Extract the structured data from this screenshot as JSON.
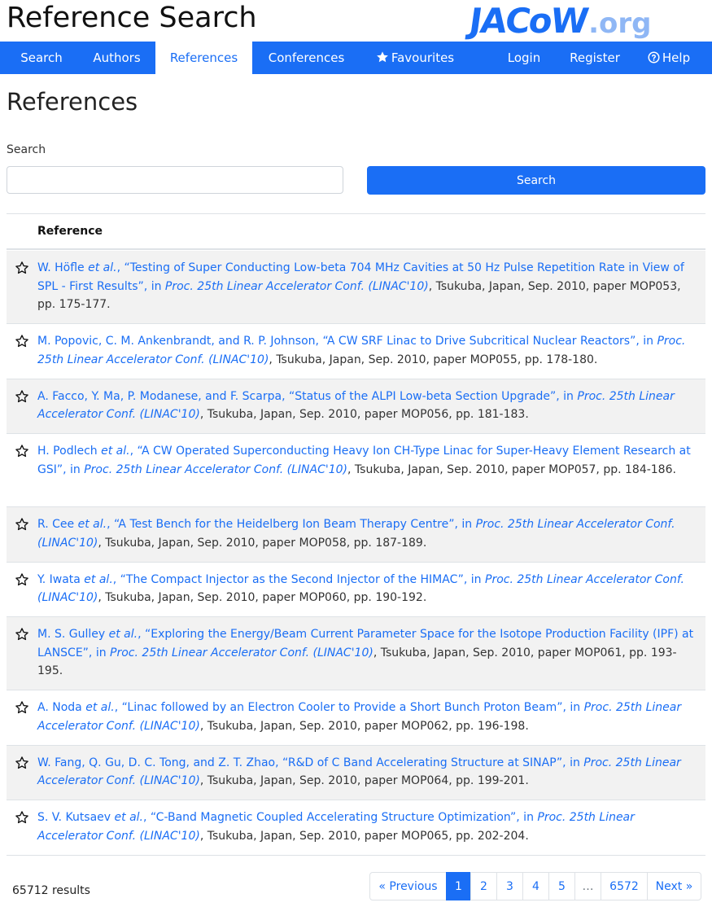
{
  "header": {
    "title": "Reference Search",
    "logo_main": "JACoW",
    "logo_ext": ".org"
  },
  "nav": {
    "search": "Search",
    "authors": "Authors",
    "references": "References",
    "conferences": "Conferences",
    "favourites": "Favourites",
    "login": "Login",
    "register": "Register",
    "help": "Help"
  },
  "page": {
    "heading": "References",
    "search_label": "Search",
    "search_value": "",
    "search_button": "Search",
    "column_header": "Reference"
  },
  "references": [
    {
      "authors": "W. Höfle",
      "etal": "et al.",
      "title": ", “Testing of Super Conducting Low-beta 704 MHz Cavities at 50 Hz Pulse Repetition Rate in View of SPL - First Results”, in ",
      "conf": "Proc. 25th Linear Accelerator Conf. (LINAC'10)",
      "details": ", Tsukuba, Japan, Sep. 2010, paper MOP053, pp. 175-177."
    },
    {
      "authors": "M. Popovic, C. M. Ankenbrandt, and R. P. Johnson",
      "etal": "",
      "title": ", “A CW SRF Linac to Drive Subcritical Nuclear Reactors”, in ",
      "conf": "Proc. 25th Linear Accelerator Conf. (LINAC'10)",
      "details": ", Tsukuba, Japan, Sep. 2010, paper MOP055, pp. 178-180."
    },
    {
      "authors": "A. Facco, Y. Ma, P. Modanese, and F. Scarpa",
      "etal": "",
      "title": ", “Status of the ALPI Low-beta Section Upgrade”, in ",
      "conf": "Proc. 25th Linear Accelerator Conf. (LINAC'10)",
      "details": ", Tsukuba, Japan, Sep. 2010, paper MOP056, pp. 181-183."
    },
    {
      "authors": "H. Podlech",
      "etal": "et al.",
      "title": ", “A CW Operated Superconducting Heavy Ion CH-Type Linac for Super-Heavy Element Research at GSI”, in ",
      "conf": "Proc. 25th Linear Accelerator Conf. (LINAC'10)",
      "details": ", Tsukuba, Japan, Sep. 2010, paper MOP057, pp. 184-186."
    },
    {
      "authors": "R. Cee",
      "etal": "et al.",
      "title": ", “A Test Bench for the Heidelberg Ion Beam Therapy Centre”, in ",
      "conf": "Proc. 25th Linear Accelerator Conf. (LINAC'10)",
      "details": ", Tsukuba, Japan, Sep. 2010, paper MOP058, pp. 187-189."
    },
    {
      "authors": "Y. Iwata",
      "etal": "et al.",
      "title": ", “The Compact Injector as the Second Injector of the HIMAC”, in ",
      "conf": "Proc. 25th Linear Accelerator Conf. (LINAC'10)",
      "details": ", Tsukuba, Japan, Sep. 2010, paper MOP060, pp. 190-192."
    },
    {
      "authors": "M. S. Gulley",
      "etal": "et al.",
      "title": ", “Exploring the Energy/Beam Current Parameter Space for the Isotope Production Facility (IPF) at LANSCE”, in ",
      "conf": "Proc. 25th Linear Accelerator Conf. (LINAC'10)",
      "details": ", Tsukuba, Japan, Sep. 2010, paper MOP061, pp. 193-195."
    },
    {
      "authors": "A. Noda",
      "etal": "et al.",
      "title": ", “Linac followed by an Electron Cooler to Provide a Short Bunch Proton Beam”, in ",
      "conf": "Proc. 25th Linear Accelerator Conf. (LINAC'10)",
      "details": ", Tsukuba, Japan, Sep. 2010, paper MOP062, pp. 196-198."
    },
    {
      "authors": "W. Fang, Q. Gu, D. C. Tong, and Z. T. Zhao",
      "etal": "",
      "title": ", “R&D of C Band Accelerating Structure at SINAP”, in ",
      "conf": "Proc. 25th Linear Accelerator Conf. (LINAC'10)",
      "details": ", Tsukuba, Japan, Sep. 2010, paper MOP064, pp. 199-201."
    },
    {
      "authors": "S. V. Kutsaev",
      "etal": "et al.",
      "title": ", “C-Band Magnetic Coupled Accelerating Structure Optimization”, in ",
      "conf": "Proc. 25th Linear Accelerator Conf. (LINAC'10)",
      "details": ", Tsukuba, Japan, Sep. 2010, paper MOP065, pp. 202-204."
    }
  ],
  "footer": {
    "results_count": "65712 results"
  },
  "pagination": {
    "previous": "« Previous",
    "pages": [
      "1",
      "2",
      "3",
      "4",
      "5",
      "…",
      "6572"
    ],
    "active_page": "1",
    "next": "Next »"
  },
  "colors": {
    "accent": "#1a6ef5",
    "row_stripe": "#f2f2f2"
  },
  "icons": [
    "star-icon",
    "question-circle-icon"
  ]
}
